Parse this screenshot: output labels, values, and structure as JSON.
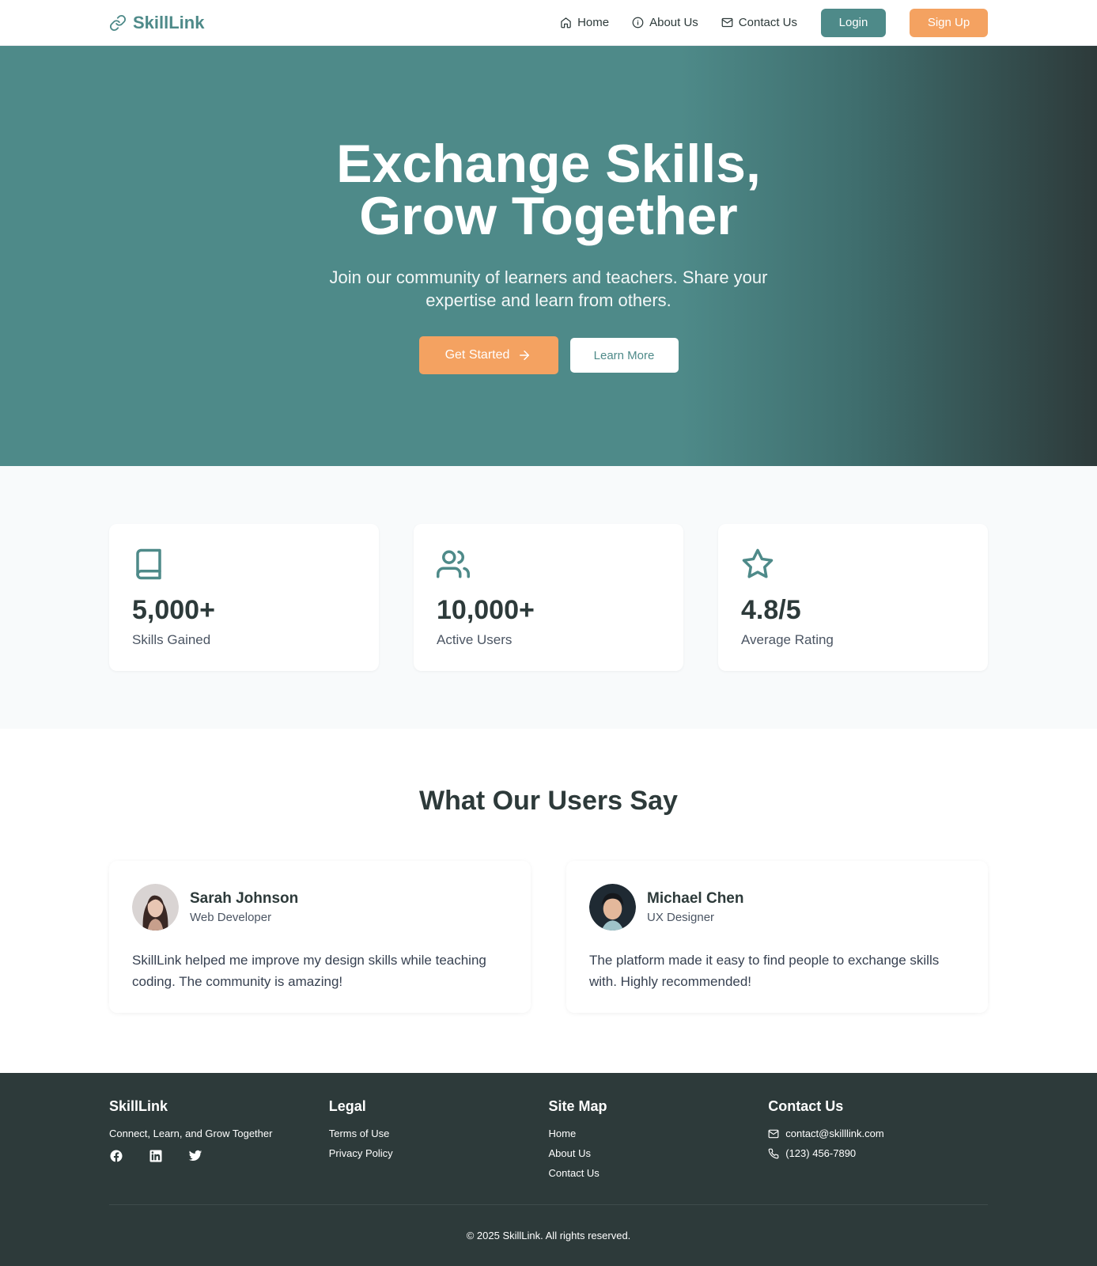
{
  "nav": {
    "brand": "SkillLink",
    "links": {
      "home": "Home",
      "about": "About Us",
      "contact": "Contact Us"
    },
    "login": "Login",
    "signup": "Sign Up"
  },
  "hero": {
    "title_line1": "Exchange Skills,",
    "title_line2": "Grow Together",
    "subtitle": "Join our community of learners and teachers. Share your expertise and learn from others.",
    "cta_primary": "Get Started",
    "cta_secondary": "Learn More"
  },
  "stats": [
    {
      "icon": "book-icon",
      "value": "5,000+",
      "label": "Skills Gained"
    },
    {
      "icon": "users-icon",
      "value": "10,000+",
      "label": "Active Users"
    },
    {
      "icon": "star-icon",
      "value": "4.8/5",
      "label": "Average Rating"
    }
  ],
  "testimonials": {
    "heading": "What Our Users Say",
    "items": [
      {
        "name": "Sarah Johnson",
        "role": "Web Developer",
        "quote": "SkillLink helped me improve my design skills while teaching coding. The community is amazing!"
      },
      {
        "name": "Michael Chen",
        "role": "UX Designer",
        "quote": "The platform made it easy to find people to exchange skills with. Highly recommended!"
      }
    ]
  },
  "footer": {
    "brand": "SkillLink",
    "tagline": "Connect, Learn, and Grow Together",
    "legal_title": "Legal",
    "legal_links": [
      "Terms of Use",
      "Privacy Policy"
    ],
    "sitemap_title": "Site Map",
    "sitemap_links": [
      "Home",
      "About Us",
      "Contact Us"
    ],
    "contact_title": "Contact Us",
    "email": "contact@skilllink.com",
    "phone": "(123) 456-7890",
    "copyright": "© 2025 SkillLink. All rights reserved."
  },
  "colors": {
    "primary": "#4e8a89",
    "accent": "#f4a261",
    "dark": "#2d3a3a"
  }
}
